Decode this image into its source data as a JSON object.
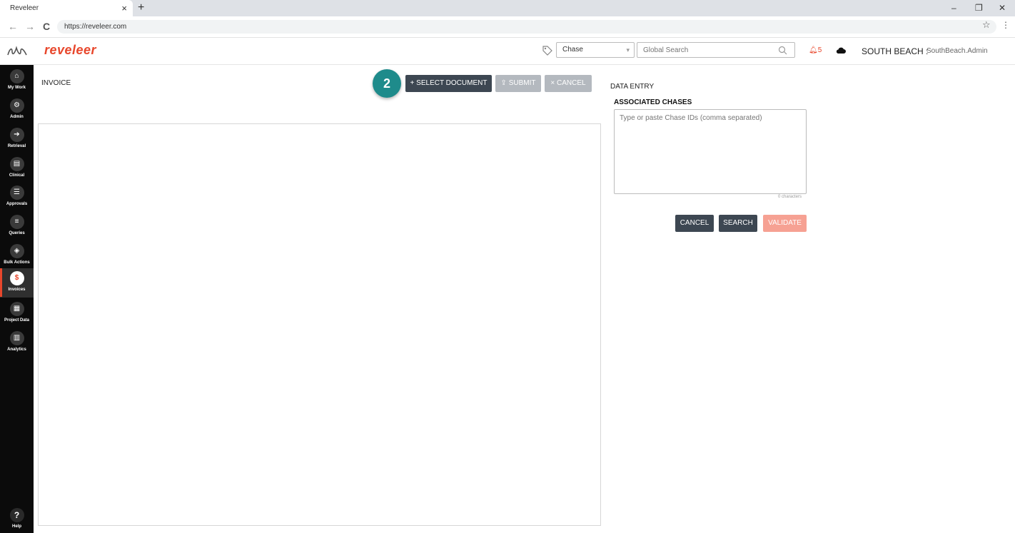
{
  "browser": {
    "tab_title": "Reveleer",
    "tab_close": "×",
    "new_tab": "+",
    "url": "https://reveleer.com",
    "minimize": "–",
    "restore": "❐",
    "close": "✕",
    "back": "←",
    "forward": "→",
    "reload": "C",
    "star": "☆",
    "menu": "⋮"
  },
  "header": {
    "brand": "reveleer",
    "chase_select": {
      "value": "Chase",
      "caret": "▾"
    },
    "global_search": {
      "placeholder": "Global Search",
      "value": ""
    },
    "notification_count": "5",
    "organization": "SOUTH BEACH :",
    "user": "SouthBeach.Admin"
  },
  "sidebar": {
    "items": [
      {
        "label": "My Work",
        "glyph": "⌂"
      },
      {
        "label": "Admin",
        "glyph": "⚙"
      },
      {
        "label": "Retrieval",
        "glyph": "➔"
      },
      {
        "label": "Clinical",
        "glyph": "▤"
      },
      {
        "label": "Approvals",
        "glyph": "☰"
      },
      {
        "label": "Queries",
        "glyph": "≡"
      },
      {
        "label": "Bulk Actions",
        "glyph": "◈"
      },
      {
        "label": "Invoices",
        "glyph": "$"
      },
      {
        "label": "Project Data",
        "glyph": "▦"
      },
      {
        "label": "Analytics",
        "glyph": "▥"
      }
    ],
    "active": "Invoices",
    "help": {
      "label": "Help",
      "glyph": "?"
    }
  },
  "invoice": {
    "title": "INVOICE",
    "step": "2",
    "select_document": "+ SELECT DOCUMENT",
    "submit": "⇪ SUBMIT",
    "cancel": "× CANCEL"
  },
  "data_entry": {
    "title": "DATA ENTRY",
    "associated_chases": "ASSOCIATED CHASES",
    "chase_ids": {
      "placeholder": "Type or paste Chase IDs (comma separated)",
      "value": ""
    },
    "char_count": "0 characters",
    "cancel": "CANCEL",
    "search": "SEARCH",
    "validate": "VALIDATE"
  },
  "colors": {
    "brand": "#e8472c",
    "primary_button": "#3d4752",
    "disabled_button": "#b4b9bf",
    "validate_button": "#f6a193",
    "step_badge": "#1e8b8b",
    "sidebar": "#0b0b0b"
  }
}
